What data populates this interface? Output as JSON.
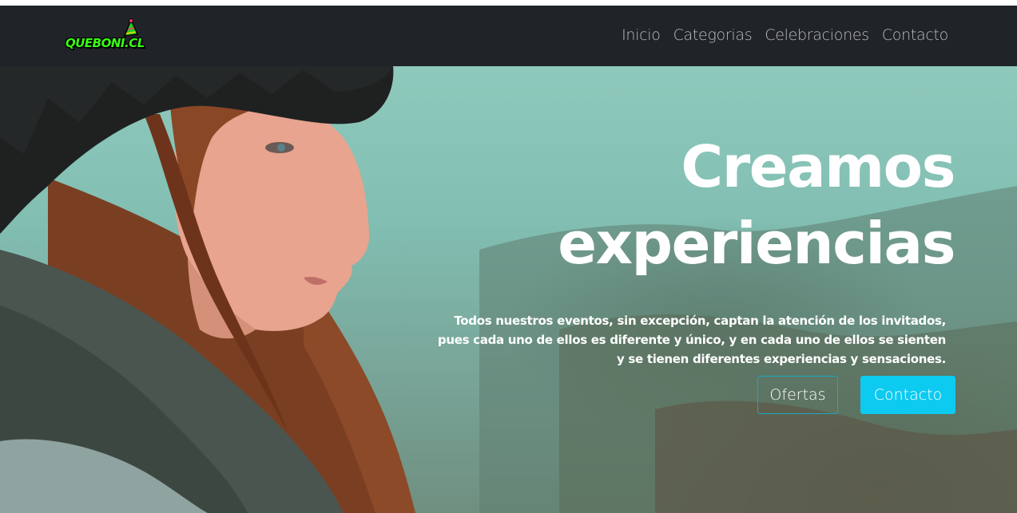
{
  "brand": {
    "logo_text": "QUEBONI.CL",
    "logo_icon": "party-hat-icon"
  },
  "nav": {
    "items": [
      {
        "label": "Inicio"
      },
      {
        "label": "Categorias"
      },
      {
        "label": "Celebraciones"
      },
      {
        "label": "Contacto"
      }
    ]
  },
  "hero": {
    "title_line1": "Creamos",
    "title_line2": "experiencias",
    "description": "Todos nuestros eventos, sin excepción, captan la atención de los invitados, pues cada uno de ellos es diferente y único, y en cada uno de ellos se sienten y se tienen diferentes experiencias y sensaciones.",
    "buttons": {
      "ofertas": "Ofertas",
      "contacto": "Contacto"
    }
  },
  "colors": {
    "navbar_bg": "#202327",
    "nav_link": "#b9bcc0",
    "accent": "#0dcaf0",
    "logo_green": "#39ff14"
  }
}
